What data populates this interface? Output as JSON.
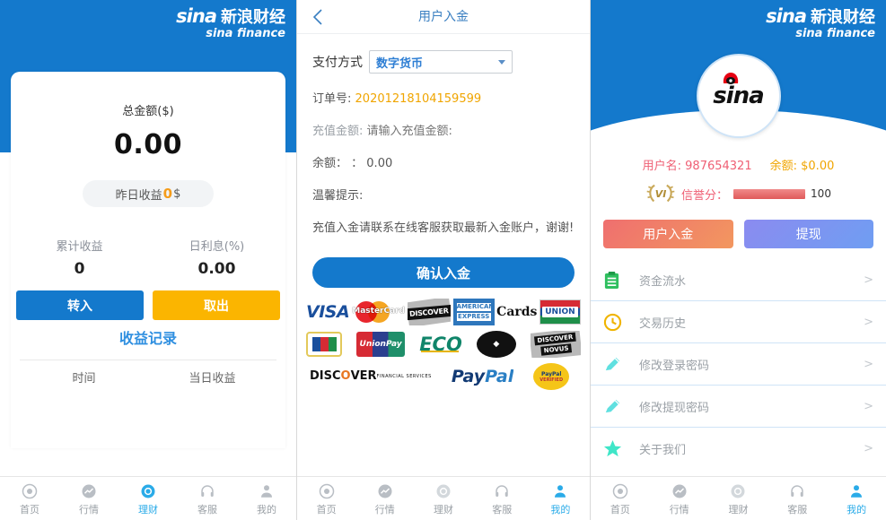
{
  "brand": {
    "sina_word": "sina",
    "cn_name": "新浪财经",
    "en_name": "sina finance"
  },
  "panel_wealth": {
    "total_label": "总金额($)",
    "total_value": "0.00",
    "yield_prefix": "昨日收益",
    "yield_value": "0",
    "yield_suffix": "$",
    "stats": [
      {
        "key": "累计收益",
        "value": "0"
      },
      {
        "key": "日利息(%)",
        "value": "0.00"
      }
    ],
    "actions": {
      "transfer_in": "转入",
      "take_out": "取出"
    },
    "record_link": "收益记录",
    "table": {
      "columns": [
        "时间",
        "当日收益"
      ],
      "rows": []
    },
    "tabbar": [
      {
        "label": "首页",
        "icon": "home-icon",
        "active": false
      },
      {
        "label": "行情",
        "icon": "market-icon",
        "active": false
      },
      {
        "label": "理财",
        "icon": "wealth-icon",
        "active": true
      },
      {
        "label": "客服",
        "icon": "support-icon",
        "active": false
      },
      {
        "label": "我的",
        "icon": "profile-icon",
        "active": false
      }
    ]
  },
  "panel_deposit": {
    "title": "用户入金",
    "back_icon": "back-chevron-icon",
    "pay_method_label": "支付方式",
    "pay_method_value": "数字货币",
    "order_label": "订单号:",
    "order_value": "20201218104159599",
    "amount_label": "充值金额:",
    "amount_placeholder": "请输入充值金额:",
    "amount_value": "",
    "balance_label": "余额：",
    "balance_value": "： 0.00",
    "tip_title": "温馨提示:",
    "tip_text": "充值入金请联系在线客服获取最新入金账户，谢谢!",
    "confirm_label": "确认入金",
    "card_logos": [
      [
        "visa",
        "mastercard",
        "discover",
        "american-express",
        "cards-text",
        "union"
      ],
      [
        "jcb",
        "unionpay",
        "eco",
        "maestro",
        "discover-novus"
      ],
      [
        "discover-financial-services",
        "paypal",
        "paypal-verified"
      ]
    ],
    "tabbar": [
      {
        "label": "首页",
        "icon": "home-icon",
        "active": false
      },
      {
        "label": "行情",
        "icon": "market-icon",
        "active": false
      },
      {
        "label": "理财",
        "icon": "wealth-icon",
        "active": false
      },
      {
        "label": "客服",
        "icon": "support-icon",
        "active": false
      },
      {
        "label": "我的",
        "icon": "profile-icon",
        "active": true
      }
    ]
  },
  "panel_profile": {
    "avatar_icon": "sina-avatar-icon",
    "username_label": "用户名:",
    "username_value": "987654321",
    "balance_label": "余额:",
    "balance_value": "$0.00",
    "badge_text": "VI",
    "score_label": "信誉分：",
    "score_value": "100",
    "actions": {
      "deposit": "用户入金",
      "withdraw": "提现"
    },
    "menu": [
      {
        "label": "资金流水",
        "icon": "clipboard-icon",
        "color": "#2fbf5f",
        "arrow": ">"
      },
      {
        "label": "交易历史",
        "icon": "clock-icon",
        "color": "#f0b400",
        "arrow": ">"
      },
      {
        "label": "修改登录密码",
        "icon": "pencil-icon",
        "color": "#5fe0e0",
        "arrow": ">"
      },
      {
        "label": "修改提现密码",
        "icon": "pencil-icon",
        "color": "#5fe0e0",
        "arrow": ">"
      },
      {
        "label": "关于我们",
        "icon": "star-icon",
        "color": "#3fe6c8",
        "arrow": ">"
      }
    ],
    "tabbar": [
      {
        "label": "首页",
        "icon": "home-icon",
        "active": false
      },
      {
        "label": "行情",
        "icon": "market-icon",
        "active": false
      },
      {
        "label": "理财",
        "icon": "wealth-icon",
        "active": false
      },
      {
        "label": "客服",
        "icon": "support-icon",
        "active": false
      },
      {
        "label": "我的",
        "icon": "profile-icon",
        "active": true
      }
    ]
  },
  "colors": {
    "brand_blue": "#1479cc",
    "accent_orange": "#fbb500",
    "link_blue": "#2f8fe0",
    "pink": "#ef5f74",
    "gold": "#f0a500",
    "tab_active": "#2aabe8"
  }
}
